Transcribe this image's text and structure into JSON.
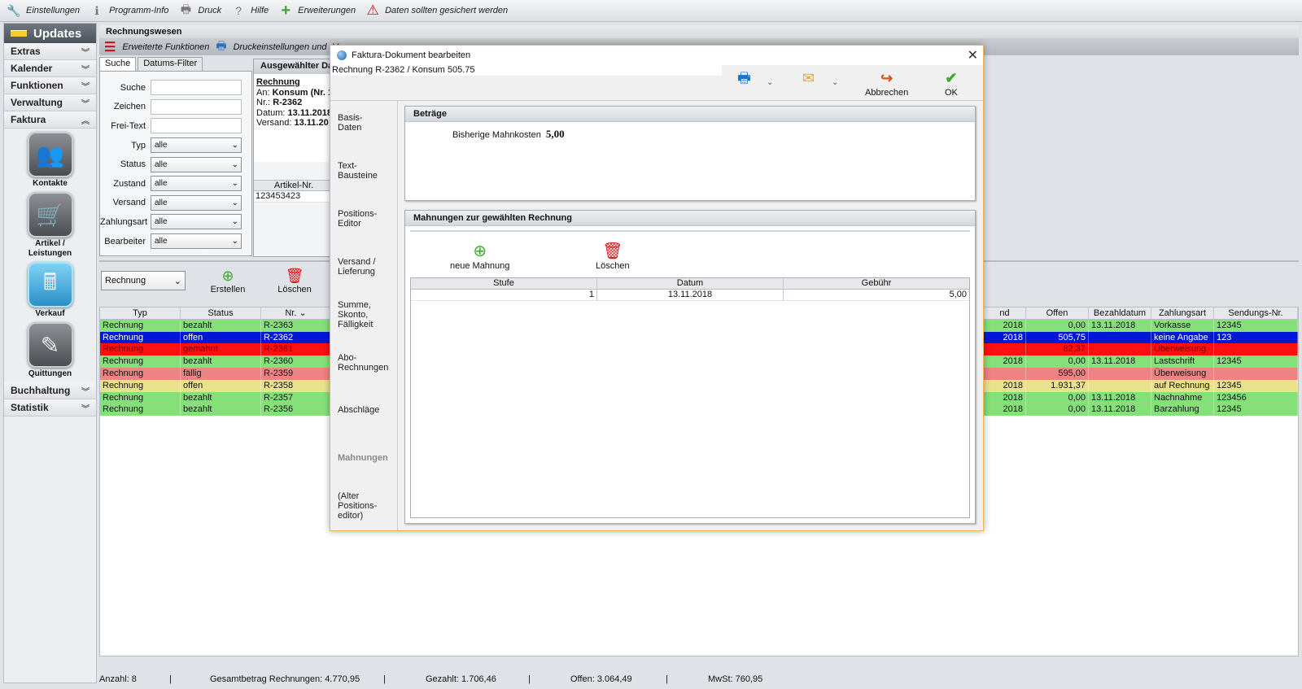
{
  "topbar": {
    "items": [
      {
        "label": "Einstellungen",
        "icon": "wrench-icon",
        "glyph": "🔧"
      },
      {
        "label": "Programm-Info",
        "icon": "info-icon",
        "glyph": "ℹ"
      },
      {
        "label": "Druck",
        "icon": "printer-icon",
        "glyph": "🖶"
      },
      {
        "label": "Hilfe",
        "icon": "question-icon",
        "glyph": "?"
      },
      {
        "label": "Erweiterungen",
        "icon": "plus-icon",
        "glyph": "+"
      },
      {
        "label": "Daten sollten gesichert werden",
        "icon": "warning-icon",
        "glyph": "⚠"
      }
    ]
  },
  "sidebar": {
    "title": "Updates",
    "sections_top": [
      "Extras",
      "Kalender",
      "Funktionen",
      "Verwaltung"
    ],
    "active_section": "Faktura",
    "modules": [
      "Kontakte",
      "Artikel / Leistungen",
      "Verkauf",
      "Quittungen"
    ],
    "sections_bottom": [
      "Buchhaltung",
      "Statistik"
    ]
  },
  "main": {
    "title": "Rechnungswesen",
    "toolbar": {
      "extended": "Erweiterte Funktionen",
      "print": "Druckeinstellungen und -V"
    }
  },
  "filter": {
    "tabs": [
      "Suche",
      "Datums-Filter"
    ],
    "text_fields": [
      "Suche",
      "Zeichen",
      "Frei-Text"
    ],
    "select_fields": [
      {
        "label": "Typ",
        "value": "alle"
      },
      {
        "label": "Status",
        "value": "alle"
      },
      {
        "label": "Zustand",
        "value": "alle"
      },
      {
        "label": "Versand",
        "value": "alle"
      },
      {
        "label": "Zahlungsart",
        "value": "alle"
      },
      {
        "label": "Bearbeiter",
        "value": "alle"
      }
    ]
  },
  "selected": {
    "title": "Ausgewählter Da",
    "heading": "Rechnung",
    "an_label": "An:",
    "an_value": "Konsum (Nr. 1",
    "nr_label": "Nr.:",
    "nr_value": "R-2362",
    "datum_label": "Datum:",
    "datum_value": "13.11.2018",
    "versand_label": "Versand:",
    "versand_value": "13.11.20",
    "article_header": "Artikel-Nr.",
    "article_value": "123453423"
  },
  "list": {
    "type_select": "Rechnung",
    "create_label": "Erstellen",
    "delete_label": "Löschen",
    "columns_left": [
      "Typ",
      "Status",
      "Nr."
    ],
    "columns_right": [
      "nd",
      "Offen",
      "Bezahldatum",
      "Zahlungsart",
      "Sendungs-Nr."
    ],
    "rows": [
      {
        "typ": "Rechnung",
        "status": "bezahlt",
        "nr": "R-2363",
        "nd": "2018",
        "offen": "0,00",
        "bezahldatum": "13.11.2018",
        "zahlungsart": "Vorkasse",
        "sendung": "12345",
        "bg": "#86e07a",
        "fg": "#111111"
      },
      {
        "typ": "Rechnung",
        "status": "offen",
        "nr": "R-2362",
        "nd": "2018",
        "offen": "505,75",
        "bezahldatum": "",
        "zahlungsart": "keine Angabe",
        "sendung": "123",
        "bg": "#0018d6",
        "fg": "#ffffff"
      },
      {
        "typ": "Rechnung",
        "status": "gemahnt",
        "nr": "R-2361",
        "nd": "",
        "offen": "82,37",
        "bezahldatum": "",
        "zahlungsart": "Überweisung",
        "sendung": "",
        "bg": "#ff1010",
        "fg": "#7a0000"
      },
      {
        "typ": "Rechnung",
        "status": "bezahlt",
        "nr": "R-2360",
        "nd": "2018",
        "offen": "0,00",
        "bezahldatum": "13.11.2018",
        "zahlungsart": "Lastschrift",
        "sendung": "12345",
        "bg": "#86e07a",
        "fg": "#111111"
      },
      {
        "typ": "Rechnung",
        "status": "fällig",
        "nr": "R-2359",
        "nd": "",
        "offen": "595,00",
        "bezahldatum": "",
        "zahlungsart": "Überweisung",
        "sendung": "",
        "bg": "#ee8383",
        "fg": "#111111"
      },
      {
        "typ": "Rechnung",
        "status": "offen",
        "nr": "R-2358",
        "nd": "2018",
        "offen": "1.931,37",
        "bezahldatum": "",
        "zahlungsart": "auf Rechnung",
        "sendung": "12345",
        "bg": "#e8e38a",
        "fg": "#111111"
      },
      {
        "typ": "Rechnung",
        "status": "bezahlt",
        "nr": "R-2357",
        "nd": "2018",
        "offen": "0,00",
        "bezahldatum": "13.11.2018",
        "zahlungsart": "Nachnahme",
        "sendung": "123456",
        "bg": "#86e07a",
        "fg": "#111111"
      },
      {
        "typ": "Rechnung",
        "status": "bezahlt",
        "nr": "R-2356",
        "nd": "2018",
        "offen": "0,00",
        "bezahldatum": "13.11.2018",
        "zahlungsart": "Barzahlung",
        "sendung": "12345",
        "bg": "#86e07a",
        "fg": "#111111"
      }
    ]
  },
  "statusbar": {
    "anzahl": "Anzahl: 8",
    "gesamt": "Gesamtbetrag Rechnungen: 4.770,95",
    "gezahlt": "Gezahlt: 1.706,46",
    "offen": "Offen: 3.064,49",
    "mwst": "MwSt: 760,95"
  },
  "dialog": {
    "title": "Faktura-Dokument bearbeiten",
    "subtitle": "Rechnung R-2362 / Konsum 505.75",
    "close": "✕",
    "toolbar": {
      "cancel": "Abbrechen",
      "ok": "OK"
    },
    "nav": [
      "Basis-\nDaten",
      "Text-\nBausteine",
      "Positions-\nEditor",
      "Versand /\nLieferung",
      "Summe,\nSkonto,\nFälligkeit",
      "Abo-\nRechnungen",
      "Abschläge",
      "Mahnungen",
      "(Alter\nPositions-\neditor)"
    ],
    "active_nav": 7,
    "betraege": {
      "title": "Beträge",
      "label": "Bisherige Mahnkosten",
      "value": "5,00"
    },
    "mahnungen": {
      "title": "Mahnungen zur gewählten Rechnung",
      "new_label": "neue Mahnung",
      "delete_label": "Löschen",
      "columns": [
        "Stufe",
        "Datum",
        "Gebühr"
      ],
      "rows": [
        {
          "stufe": "1",
          "datum": "13.11.2018",
          "gebuehr": "5,00"
        }
      ]
    }
  }
}
